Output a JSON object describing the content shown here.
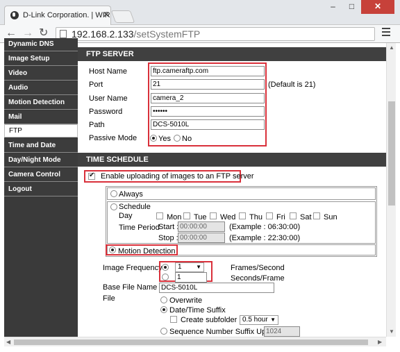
{
  "browser": {
    "tab_title": "D-Link Corporation. | WIR",
    "tab_close": "✕",
    "win_min": "‒",
    "win_max": "□",
    "win_close": "✕",
    "url_host": "192.168.2.133",
    "url_path": "/setSystemFTP"
  },
  "sidebar": {
    "items": [
      {
        "label": "Dynamic DNS"
      },
      {
        "label": "Image Setup"
      },
      {
        "label": "Video"
      },
      {
        "label": "Audio"
      },
      {
        "label": "Motion Detection"
      },
      {
        "label": "Mail"
      },
      {
        "label": "FTP"
      },
      {
        "label": "Time and Date"
      },
      {
        "label": "Day/Night Mode"
      },
      {
        "label": "Camera Control"
      },
      {
        "label": "Logout"
      }
    ]
  },
  "ftp": {
    "title": "FTP SERVER",
    "host_label": "Host Name",
    "host_value": "ftp.cameraftp.com",
    "port_label": "Port",
    "port_value": "21",
    "port_default": "(Default is 21)",
    "user_label": "User Name",
    "user_value": "camera_2",
    "password_label": "Password",
    "password_value": "••••••",
    "path_label": "Path",
    "path_value": "DCS-5010L",
    "passive_label": "Passive Mode",
    "passive_yes": "Yes",
    "passive_no": "No"
  },
  "schedule": {
    "title": "TIME SCHEDULE",
    "enable_label": "Enable uploading of images to an FTP server",
    "always": "Always",
    "schedule": "Schedule",
    "day_label": "Day",
    "days": [
      "Mon",
      "Tue",
      "Wed",
      "Thu",
      "Fri",
      "Sat",
      "Sun"
    ],
    "time_period": "Time Period",
    "start_label": "Start :",
    "start_value": "00:00:00",
    "start_example": "(Example : 06:30:00)",
    "stop_label": "Stop :",
    "stop_value": "00:00:00",
    "stop_example": "(Example : 22:30:00)",
    "motion": "Motion Detection",
    "image_freq_label": "Image Frequency",
    "freq_select": "1",
    "freq_unit1": "Frames/Second",
    "freq_input": "1",
    "freq_unit2": "Seconds/Frame",
    "base_label": "Base File Name",
    "base_value": "DCS-5010L",
    "file_label": "File",
    "overwrite": "Overwrite",
    "datetime_suffix": "Date/Time Suffix",
    "create_subfolder": "Create subfolder by",
    "subfolder_value": "0.5 hour",
    "sequence_suffix": "Sequence Number Suffix Up to",
    "sequence_value": "1024"
  }
}
